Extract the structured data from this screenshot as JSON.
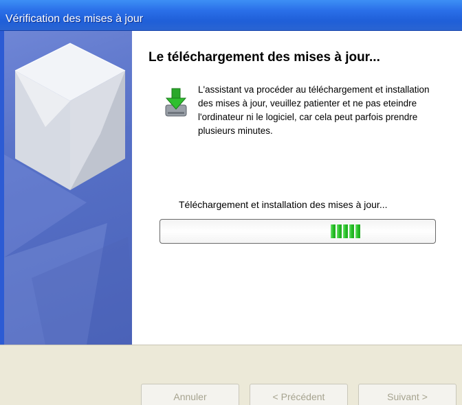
{
  "window": {
    "title": "Vérification des mises à jour"
  },
  "content": {
    "heading": "Le téléchargement des mises à jour...",
    "icon": "download-drive-icon",
    "description": "L'assistant va procéder au téléchargement et installation des mises à jour, veuillez patienter et ne pas eteindre l'ordinateur ni le logiciel, car cela peut parfois prendre plusieurs minutes.",
    "status": "Téléchargement et installation des mises à jour..."
  },
  "progress": {
    "style": "marquee",
    "color": "#27c227"
  },
  "buttons": {
    "cancel": {
      "label": "Annuler",
      "enabled": false
    },
    "back": {
      "label": "< Précédent",
      "enabled": false
    },
    "next": {
      "label": "Suivant >",
      "enabled": false
    }
  },
  "colors": {
    "titlebar": "#2a6fe8",
    "side_panel": "#5670c6",
    "progress_green": "#27c227"
  }
}
